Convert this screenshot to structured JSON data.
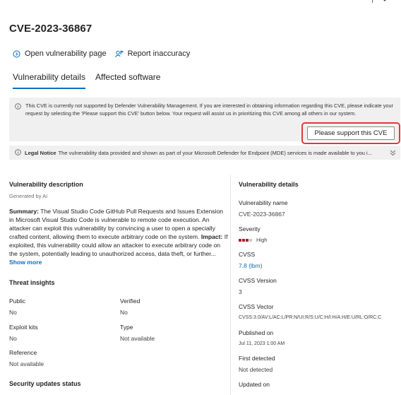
{
  "title": "CVE-2023-36867",
  "links": {
    "open": "Open vulnerability page",
    "report": "Report inaccuracy"
  },
  "tabs": [
    "Vulnerability details",
    "Affected software"
  ],
  "notice": {
    "text": "This CVE is currently not supported by Defender Vulnerability Management. If you are interested in obtaining information regarding this CVE, please indicate your request by selecting the 'Please support this CVE' button below. Your request will assist us in prioritizing this CVE among all others in our system.",
    "button": "Please support this CVE"
  },
  "legal": {
    "label": "Legal Notice",
    "text": "The vulnerability data provided and shown as part of your Microsoft Defender for Endpoint (MDE) services is made available to you i..."
  },
  "left": {
    "heading": "Vulnerability description",
    "generated": "Generated by AI",
    "summary_label": "Summary:",
    "summary_text": "The Visual Studio Code GitHub Pull Requests and Issues Extension in Microsoft Visual Studio Code is vulnerable to remote code execution. An attacker can exploit this vulnerability by convincing a user to open a specially crafted content, allowing them to execute arbitrary code on the system.",
    "impact_label": "Impact:",
    "impact_text": "If exploited, this vulnerability could allow an attacker to execute arbitrary code on the system, potentially leading to unauthorized access, data theft, or further...",
    "show_more": "Show more",
    "threat_heading": "Threat insights",
    "public_label": "Public",
    "public_value": "No",
    "verified_label": "Verified",
    "verified_value": "No",
    "exploit_label": "Exploit kits",
    "exploit_value": "No",
    "type_label": "Type",
    "type_value": "Not available",
    "reference_label": "Reference",
    "reference_value": "Not available",
    "security_heading": "Security updates status"
  },
  "right": {
    "heading": "Vulnerability details",
    "name_label": "Vulnerability name",
    "name_value": "CVE-2023-36867",
    "severity_label": "Severity",
    "severity_value": "High",
    "severity_bars": 4,
    "severity_filled": 3,
    "cvss_label": "CVSS",
    "cvss_value": "7.8",
    "cvss_link": "(lbm)",
    "version_label": "CVSS Version",
    "version_value": "3",
    "vector_label": "CVSS Vector",
    "vector_value": "CVSS:3.0/AV:L/AC:L/PR:N/UI:R/S:U/C:H/I:H/A:H/E:U/RL:O/RC:C",
    "published_label": "Published on",
    "published_value": "Jul 11, 2023 1:00 AM",
    "first_label": "First detected",
    "first_value": "Not detected",
    "updated_label": "Updated on"
  },
  "colors": {
    "accent": "#0f6cbd",
    "severity_high": "#a4262c",
    "severity_empty": "#c8c8c8",
    "highlight": "#e0383e"
  }
}
